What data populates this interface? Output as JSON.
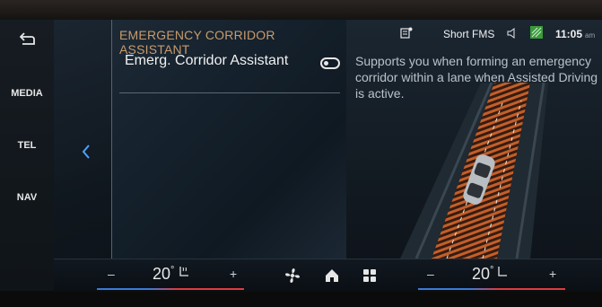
{
  "sidebar": {
    "items": [
      {
        "label": "MEDIA"
      },
      {
        "label": "TEL"
      },
      {
        "label": "NAV"
      }
    ],
    "back_icon": "back-arrow-icon"
  },
  "panel": {
    "title": "EMERGENCY CORRIDOR ASSISTANT",
    "setting_label": "Emerg. Corridor Assistant",
    "toggle_state": "off"
  },
  "description": {
    "text": "Supports you when forming an emergency corridor within a lane when Assisted Driving is active."
  },
  "status": {
    "mode": "Short FMS",
    "time": "11:05",
    "ampm": "am"
  },
  "climate": {
    "left_temp": "20",
    "right_temp": "20",
    "minus": "–",
    "plus": "+",
    "degree": "°"
  },
  "colors": {
    "accent_title": "#c79b6e",
    "heat_red": "#e03c3c",
    "cool_blue": "#3c7bd6",
    "corridor_orange": "#d5652a"
  }
}
